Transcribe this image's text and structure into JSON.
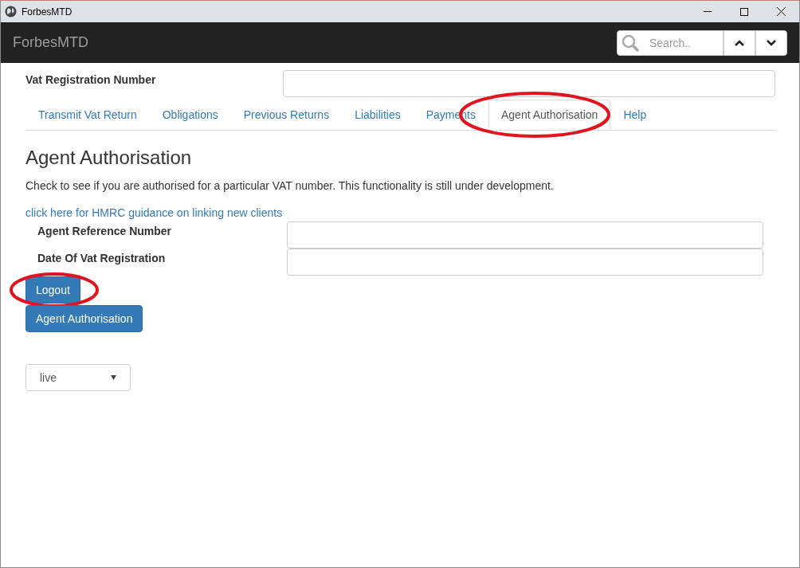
{
  "window": {
    "title": "ForbesMTD"
  },
  "navbar": {
    "brand": "ForbesMTD",
    "search": {
      "placeholder": "Search.."
    }
  },
  "vat_field": {
    "label": "Vat Registration Number"
  },
  "tabs": [
    {
      "label": "Transmit Vat Return",
      "selected": false,
      "highlighted": false
    },
    {
      "label": "Obligations",
      "selected": false,
      "highlighted": false
    },
    {
      "label": "Previous Returns",
      "selected": false,
      "highlighted": false
    },
    {
      "label": "Liabilities",
      "selected": false,
      "highlighted": false
    },
    {
      "label": "Payments",
      "selected": false,
      "highlighted": false
    },
    {
      "label": "Agent Authorisation",
      "selected": true,
      "highlighted": true
    },
    {
      "label": "Help",
      "selected": false,
      "highlighted": false
    }
  ],
  "heading": "Agent Authorisation",
  "description": "Check to see if you are authorised for a particular VAT number. This functionality is still under development.",
  "guidance_link": "click here for HMRC guidance on linking new clients",
  "fields": [
    {
      "label": "Agent Reference Number"
    },
    {
      "label": "Date Of Vat Registration"
    }
  ],
  "buttons": [
    {
      "label": "Logout",
      "highlighted": true
    },
    {
      "label": "Agent Authorisation",
      "highlighted": false
    }
  ],
  "environment_select": {
    "value": "live"
  }
}
